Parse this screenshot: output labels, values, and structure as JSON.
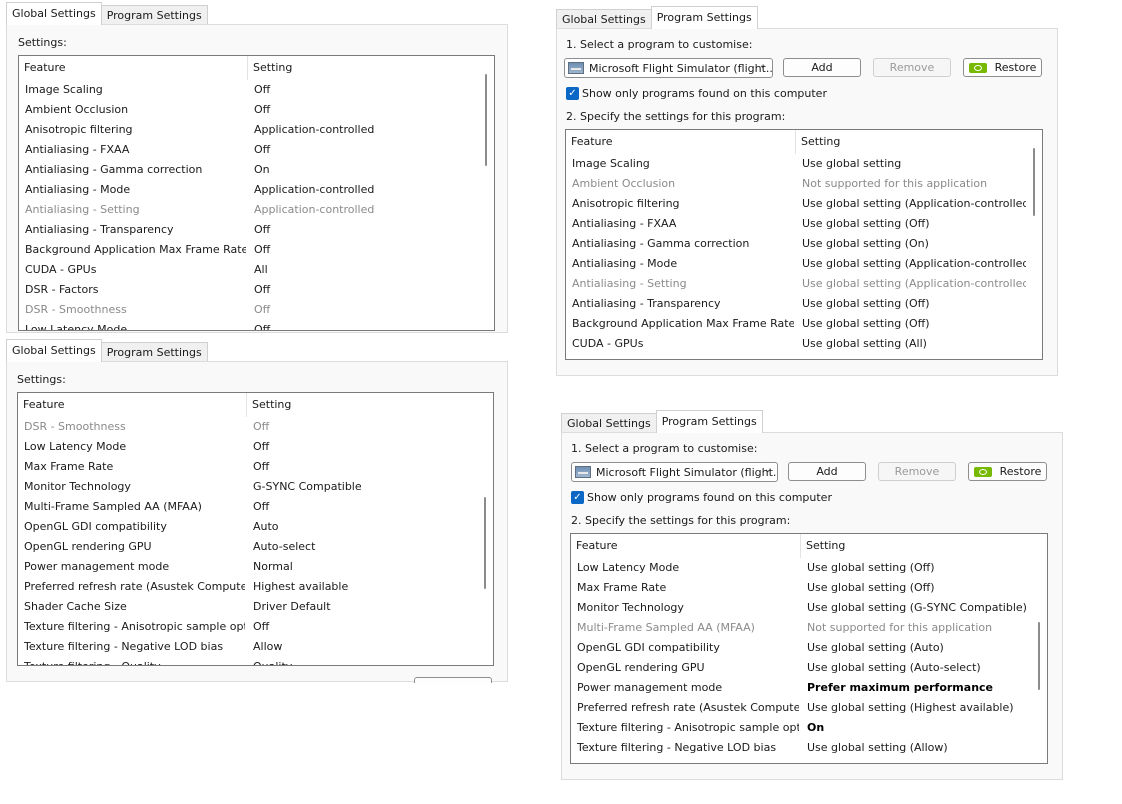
{
  "panels": {
    "global1": {
      "tabs": [
        "Global Settings",
        "Program Settings"
      ],
      "settings_label": "Settings:",
      "columns": [
        "Feature",
        "Setting"
      ],
      "rows": [
        {
          "feature": "Image Scaling",
          "setting": "Off"
        },
        {
          "feature": "Ambient Occlusion",
          "setting": "Off"
        },
        {
          "feature": "Anisotropic filtering",
          "setting": "Application-controlled"
        },
        {
          "feature": "Antialiasing - FXAA",
          "setting": "Off"
        },
        {
          "feature": "Antialiasing - Gamma correction",
          "setting": "On"
        },
        {
          "feature": "Antialiasing - Mode",
          "setting": "Application-controlled"
        },
        {
          "feature": "Antialiasing - Setting",
          "setting": "Application-controlled",
          "disabled": true
        },
        {
          "feature": "Antialiasing - Transparency",
          "setting": "Off"
        },
        {
          "feature": "Background Application Max Frame Rate",
          "setting": "Off"
        },
        {
          "feature": "CUDA - GPUs",
          "setting": "All"
        },
        {
          "feature": "DSR - Factors",
          "setting": "Off"
        },
        {
          "feature": "DSR - Smoothness",
          "setting": "Off",
          "disabled": true
        },
        {
          "feature": "Low Latency Mode",
          "setting": "Off"
        }
      ]
    },
    "global2": {
      "tabs": [
        "Global Settings",
        "Program Settings"
      ],
      "settings_label": "Settings:",
      "columns": [
        "Feature",
        "Setting"
      ],
      "rows": [
        {
          "feature": "DSR - Smoothness",
          "setting": "Off",
          "disabled": true
        },
        {
          "feature": "Low Latency Mode",
          "setting": "Off"
        },
        {
          "feature": "Max Frame Rate",
          "setting": "Off"
        },
        {
          "feature": "Monitor Technology",
          "setting": "G-SYNC Compatible"
        },
        {
          "feature": "Multi-Frame Sampled AA (MFAA)",
          "setting": "Off"
        },
        {
          "feature": "OpenGL GDI compatibility",
          "setting": "Auto"
        },
        {
          "feature": "OpenGL rendering GPU",
          "setting": "Auto-select"
        },
        {
          "feature": "Power management mode",
          "setting": "Normal"
        },
        {
          "feature": "Preferred refresh rate (Asustek Computer...",
          "setting": "Highest available"
        },
        {
          "feature": "Shader Cache Size",
          "setting": "Driver Default"
        },
        {
          "feature": "Texture filtering - Anisotropic sample opti...",
          "setting": "Off"
        },
        {
          "feature": "Texture filtering - Negative LOD bias",
          "setting": "Allow"
        },
        {
          "feature": "Texture filtering - Quality",
          "setting": "Quality"
        }
      ]
    },
    "program1": {
      "tabs": [
        "Global Settings",
        "Program Settings"
      ],
      "step1": "1. Select a program to customise:",
      "program": "Microsoft Flight Simulator (flight...",
      "add": "Add",
      "remove": "Remove",
      "restore": "Restore",
      "show_only": "Show only programs found on this computer",
      "step2": "2. Specify the settings for this program:",
      "columns": [
        "Feature",
        "Setting"
      ],
      "rows": [
        {
          "feature": "Image Scaling",
          "setting": "Use global setting"
        },
        {
          "feature": "Ambient Occlusion",
          "setting": "Not supported for this application",
          "disabled": true
        },
        {
          "feature": "Anisotropic filtering",
          "setting": "Use global setting (Application-controlled)"
        },
        {
          "feature": "Antialiasing - FXAA",
          "setting": "Use global setting (Off)"
        },
        {
          "feature": "Antialiasing - Gamma correction",
          "setting": "Use global setting (On)"
        },
        {
          "feature": "Antialiasing - Mode",
          "setting": "Use global setting (Application-controlled)"
        },
        {
          "feature": "Antialiasing - Setting",
          "setting": "Use global setting (Application-controlled)",
          "disabled": true
        },
        {
          "feature": "Antialiasing - Transparency",
          "setting": "Use global setting (Off)"
        },
        {
          "feature": "Background Application Max Frame Rate",
          "setting": "Use global setting (Off)"
        },
        {
          "feature": "CUDA - GPUs",
          "setting": "Use global setting (All)"
        }
      ]
    },
    "program2": {
      "tabs": [
        "Global Settings",
        "Program Settings"
      ],
      "step1": "1. Select a program to customise:",
      "program": "Microsoft Flight Simulator (flight...",
      "add": "Add",
      "remove": "Remove",
      "restore": "Restore",
      "show_only": "Show only programs found on this computer",
      "step2": "2. Specify the settings for this program:",
      "columns": [
        "Feature",
        "Setting"
      ],
      "rows": [
        {
          "feature": "Low Latency Mode",
          "setting": "Use global setting (Off)"
        },
        {
          "feature": "Max Frame Rate",
          "setting": "Use global setting (Off)"
        },
        {
          "feature": "Monitor Technology",
          "setting": "Use global setting (G-SYNC Compatible)"
        },
        {
          "feature": "Multi-Frame Sampled AA (MFAA)",
          "setting": "Not supported for this application",
          "disabled": true
        },
        {
          "feature": "OpenGL GDI compatibility",
          "setting": "Use global setting (Auto)"
        },
        {
          "feature": "OpenGL rendering GPU",
          "setting": "Use global setting (Auto-select)"
        },
        {
          "feature": "Power management mode",
          "setting": "Prefer maximum performance",
          "bold": true
        },
        {
          "feature": "Preferred refresh rate (Asustek Computer...",
          "setting": "Use global setting (Highest available)"
        },
        {
          "feature": "Texture filtering - Anisotropic sample opti...",
          "setting": "On",
          "bold": true
        },
        {
          "feature": "Texture filtering - Negative LOD bias",
          "setting": "Use global setting (Allow)"
        }
      ]
    }
  }
}
